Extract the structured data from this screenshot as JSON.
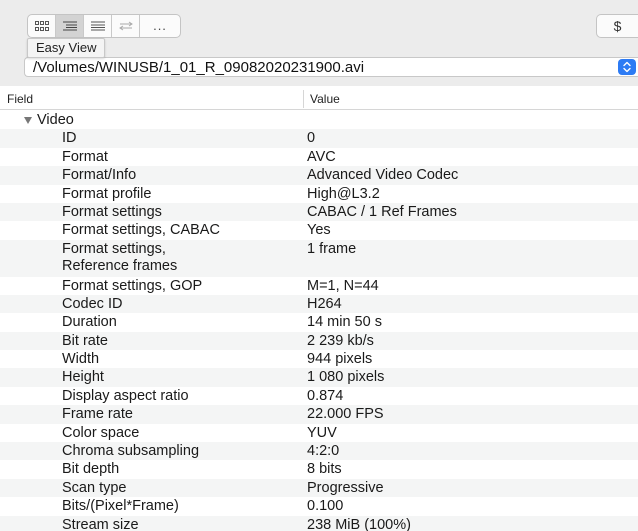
{
  "toolbar": {
    "more_label": "...",
    "tooltip": "Easy View",
    "dollar_label": "$"
  },
  "file_path": "/Volumes/WINUSB/1_01_R_09082020231900.avi",
  "table": {
    "headers": {
      "field": "Field",
      "value": "Value"
    },
    "section": "Video",
    "rows": [
      {
        "field": "ID",
        "value": "0"
      },
      {
        "field": "Format",
        "value": "AVC"
      },
      {
        "field": "Format/Info",
        "value": "Advanced Video Codec"
      },
      {
        "field": "Format profile",
        "value": "High@L3.2"
      },
      {
        "field": "Format settings",
        "value": "CABAC / 1 Ref Frames"
      },
      {
        "field": "Format settings, CABAC",
        "value": "Yes"
      },
      {
        "field": "Format settings,\nReference frames",
        "value": "1 frame"
      },
      {
        "field": "Format settings, GOP",
        "value": "M=1, N=44"
      },
      {
        "field": "Codec ID",
        "value": "H264"
      },
      {
        "field": "Duration",
        "value": "14 min 50 s"
      },
      {
        "field": "Bit rate",
        "value": "2 239 kb/s"
      },
      {
        "field": "Width",
        "value": "944 pixels"
      },
      {
        "field": "Height",
        "value": "1 080 pixels"
      },
      {
        "field": "Display aspect ratio",
        "value": "0.874"
      },
      {
        "field": "Frame rate",
        "value": "22.000 FPS"
      },
      {
        "field": "Color space",
        "value": "YUV"
      },
      {
        "field": "Chroma subsampling",
        "value": "4:2:0"
      },
      {
        "field": "Bit depth",
        "value": "8 bits"
      },
      {
        "field": "Scan type",
        "value": "Progressive"
      },
      {
        "field": "Bits/(Pixel*Frame)",
        "value": "0.100"
      },
      {
        "field": "Stream size",
        "value": "238 MiB (100%)"
      }
    ]
  },
  "colors": {
    "accent": "#2d7bf4",
    "row_alt": "#f4f5f5",
    "toolbar_bg": "#ececec"
  }
}
